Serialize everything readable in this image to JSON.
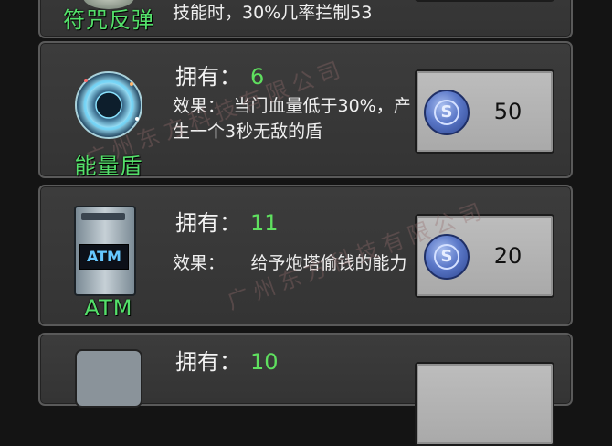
{
  "items": [
    {
      "name": "符咒反弹",
      "effect_partial": "技能时，30%几率拦制53"
    },
    {
      "name": "能量盾",
      "owned_label": "拥有：",
      "owned_value": "6",
      "effect": "效果：　当门血量低于30%，产生一个3秒无敌的盾",
      "price": "50",
      "icon": "energy-shield-icon"
    },
    {
      "name": "ATM",
      "atm_text": "ATM",
      "owned_label": "拥有：",
      "owned_value": "11",
      "effect": "效果：　　给予炮塔偷钱的能力",
      "price": "20",
      "icon": "atm-icon"
    },
    {
      "owned_label": "拥有：",
      "owned_value": "10"
    }
  ],
  "watermark": "广州东方科技有限公司",
  "coin_symbol": "S",
  "colors": {
    "accent_green": "#5fe05f",
    "label_green": "#54e06a",
    "panel": "#3a3a3a",
    "button": "#b5b5b5"
  }
}
